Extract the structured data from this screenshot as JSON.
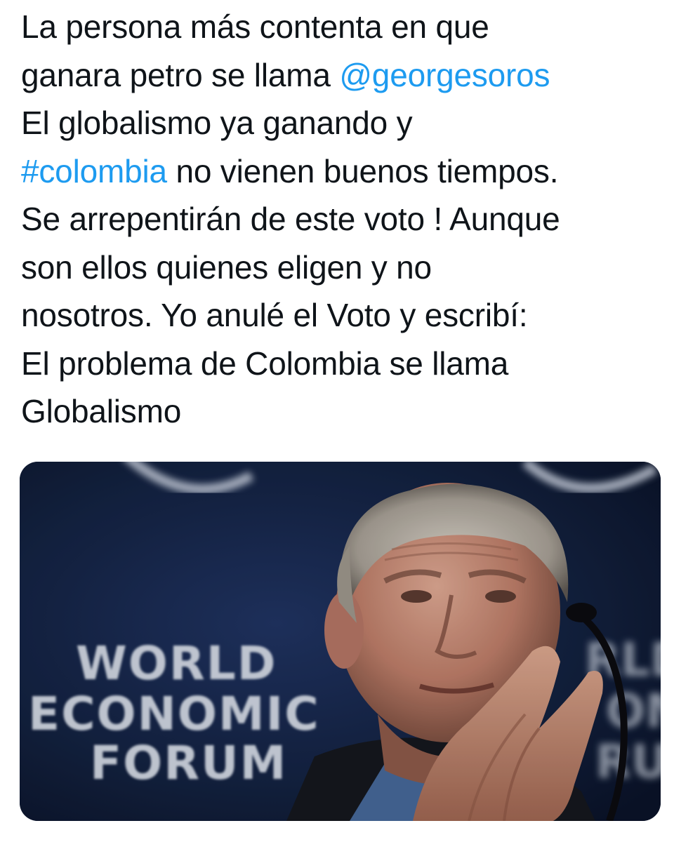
{
  "tweet": {
    "text_lines": [
      {
        "parts": [
          {
            "text": "La persona más contenta en que",
            "type": "text"
          }
        ]
      },
      {
        "parts": [
          {
            "text": "ganara petro se llama ",
            "type": "text"
          },
          {
            "text": "@georgesoros",
            "type": "mention"
          }
        ]
      },
      {
        "parts": [
          {
            "text": "El globalismo ya ganando y",
            "type": "text"
          }
        ]
      },
      {
        "parts": [
          {
            "text": "#colombia",
            "type": "hashtag"
          },
          {
            "text": " no vienen buenos tiempos.",
            "type": "text"
          }
        ]
      },
      {
        "parts": [
          {
            "text": "Se arrepentirán de este voto ! Aunque",
            "type": "text"
          }
        ]
      },
      {
        "parts": [
          {
            "text": "son ellos quienes eligen y no",
            "type": "text"
          }
        ]
      },
      {
        "parts": [
          {
            "text": "nosotros. Yo anulé el Voto y escribí:",
            "type": "text"
          }
        ]
      },
      {
        "parts": [
          {
            "text": "El problema de Colombia se llama",
            "type": "text"
          }
        ]
      },
      {
        "parts": [
          {
            "text": "Globalismo",
            "type": "text"
          }
        ]
      }
    ],
    "link_color": "#1d9bf0",
    "text_color": "#0f1419",
    "media": {
      "backdrop_text": [
        "WORLD",
        "ECONOMIC",
        "FORUM"
      ],
      "backdrop_text_right": [
        "RLD",
        "OM",
        "RUM"
      ],
      "background_color": "#0e1a33"
    }
  }
}
